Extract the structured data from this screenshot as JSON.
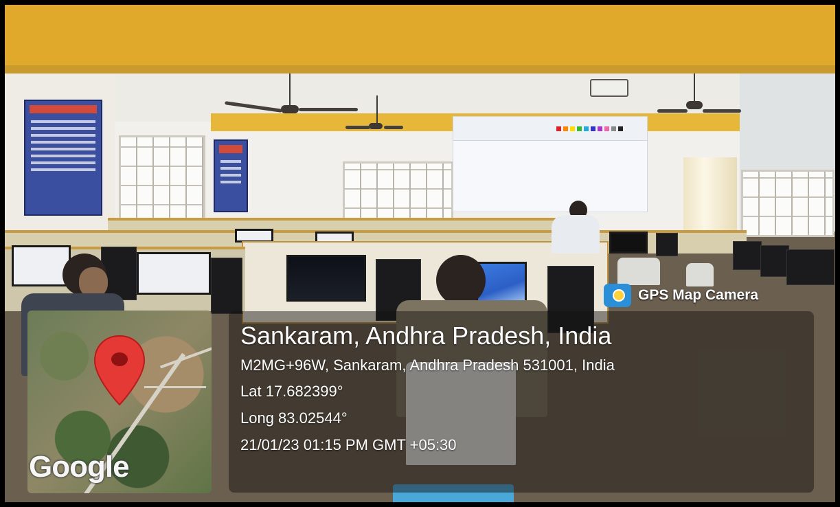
{
  "overlay": {
    "app_name": "GPS Map Camera",
    "app_icon": "gps-map-camera-icon",
    "location_title": "Sankaram, Andhra Pradesh, India",
    "address": "M2MG+96W, Sankaram, Andhra Pradesh 531001, India",
    "latitude": "Lat 17.682399°",
    "longitude": "Long 83.02544°",
    "datetime": "21/01/23 01:15 PM GMT +05:30"
  },
  "map": {
    "attribution": "Google",
    "pin_color": "#e53935"
  },
  "colors": {
    "wall_accent": "#e0a92c",
    "overlay_text": "#ffffff"
  }
}
